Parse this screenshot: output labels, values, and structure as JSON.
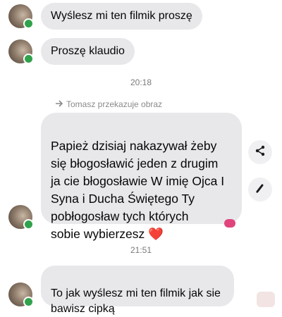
{
  "messages": {
    "m1": "Wyślesz mi ten filmik proszę",
    "m2": "Proszę klaudio",
    "forward_label": "Tomasz przekazuje obraz",
    "big_text": "Papież dzisiaj nakazywał żeby\nsię błogosławić jeden z drugim\nja cie błogosławie W imię Ojca I\nSyna i Ducha Świętego Ty\npobłogosław tych których\nsobie wybierzesz",
    "heart": "❤️",
    "m3": "To jak wyślesz mi ten filmik jak sie\nbawisz cipką"
  },
  "times": {
    "t1": "20:18",
    "t2": "21:51"
  },
  "icons": {
    "forward": "arrow-forward-icon",
    "share": "share-icon",
    "edit": "pencil-icon",
    "online": "online-status-dot",
    "reaction": "reaction-icon"
  },
  "colors": {
    "bubble": "#e8e8eb",
    "online": "#31a24c",
    "reaction": "#e0447c"
  }
}
